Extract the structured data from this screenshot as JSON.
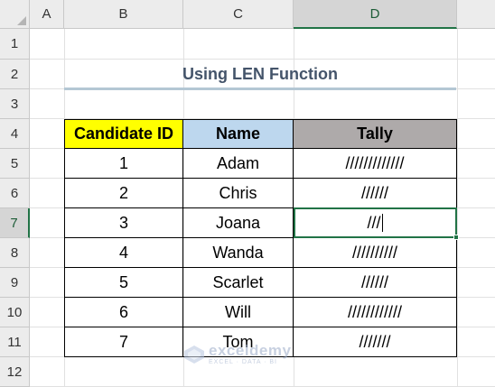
{
  "sheet": {
    "columns": [
      "A",
      "B",
      "C",
      "D"
    ],
    "rows": [
      "1",
      "2",
      "3",
      "4",
      "5",
      "6",
      "7",
      "8",
      "9",
      "10",
      "11",
      "12"
    ],
    "selected_column": "D",
    "selected_row": "7"
  },
  "title": "Using LEN Function",
  "table": {
    "headers": {
      "id": "Candidate ID",
      "name": "Name",
      "tally": "Tally"
    },
    "header_colors": {
      "id": "#ffff00",
      "name": "#bdd7ee",
      "tally": "#aeaaaa"
    },
    "rows": [
      {
        "id": "1",
        "name": "Adam",
        "tally": "/////////////"
      },
      {
        "id": "2",
        "name": "Chris",
        "tally": "//////"
      },
      {
        "id": "3",
        "name": "Joana",
        "tally": "///"
      },
      {
        "id": "4",
        "name": "Wanda",
        "tally": "//////////"
      },
      {
        "id": "5",
        "name": "Scarlet",
        "tally": "//////"
      },
      {
        "id": "6",
        "name": "Will",
        "tally": "////////////"
      },
      {
        "id": "7",
        "name": "Tom",
        "tally": "///////"
      }
    ]
  },
  "watermark": {
    "name": "exceldemy",
    "tagline": "EXCEL · DATA · BI"
  },
  "colors": {
    "accent": "#217346",
    "title": "#44546a"
  }
}
